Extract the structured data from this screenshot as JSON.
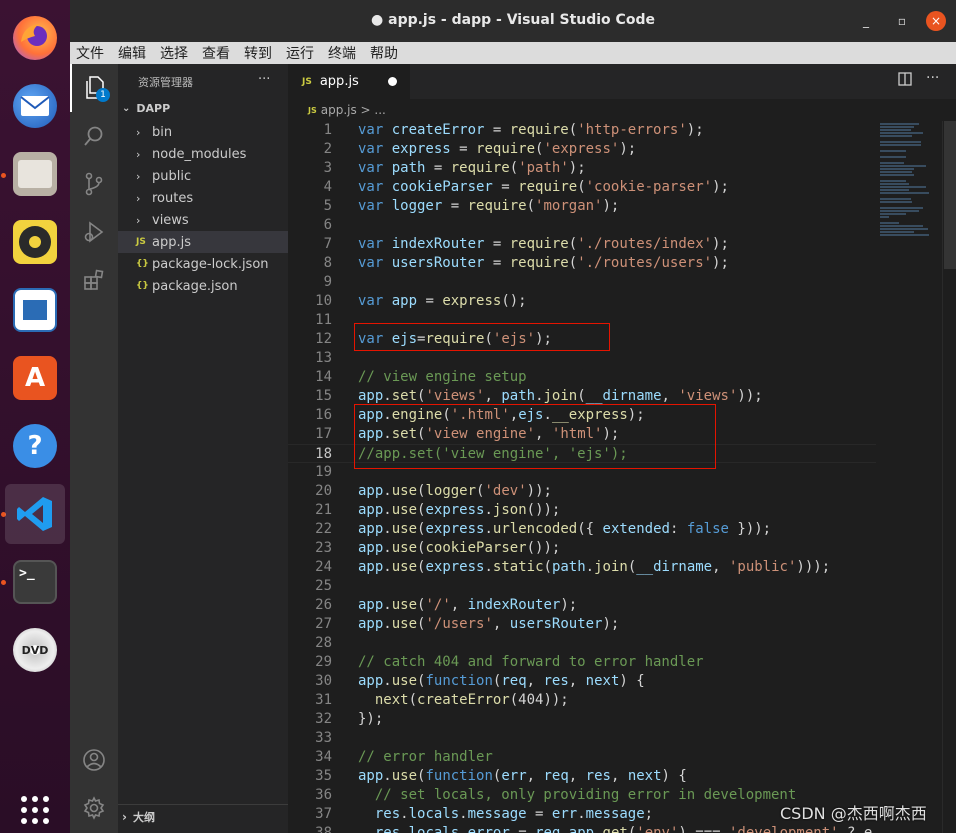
{
  "window": {
    "title": "● app.js - dapp - Visual Studio Code",
    "minimize": "_",
    "maximize": "▫",
    "close": "×"
  },
  "menu": [
    "文件",
    "编辑",
    "选择",
    "查看",
    "转到",
    "运行",
    "终端",
    "帮助"
  ],
  "activity": {
    "badge": "1"
  },
  "sidebar": {
    "title": "资源管理器",
    "more": "···",
    "root": "DAPP",
    "items": [
      {
        "label": "bin",
        "type": "folder"
      },
      {
        "label": "node_modules",
        "type": "folder"
      },
      {
        "label": "public",
        "type": "folder"
      },
      {
        "label": "routes",
        "type": "folder"
      },
      {
        "label": "views",
        "type": "folder"
      },
      {
        "label": "app.js",
        "type": "js"
      },
      {
        "label": "package-lock.json",
        "type": "json"
      },
      {
        "label": "package.json",
        "type": "json"
      }
    ],
    "outline": "大纲"
  },
  "tab": {
    "label": "app.js",
    "icon": "JS"
  },
  "breadcrumb": {
    "icon": "JS",
    "text": "app.js > ..."
  },
  "editor": {
    "current_line": 18,
    "lines": [
      {
        "n": "1",
        "t": [
          [
            "k",
            "var "
          ],
          [
            "v",
            "createError"
          ],
          [
            "p",
            " = "
          ],
          [
            "f",
            "require"
          ],
          [
            "p",
            "("
          ],
          [
            "s",
            "'http-errors'"
          ],
          [
            "p",
            ");"
          ]
        ]
      },
      {
        "n": "2",
        "t": [
          [
            "k",
            "var "
          ],
          [
            "v",
            "express"
          ],
          [
            "p",
            " = "
          ],
          [
            "f",
            "require"
          ],
          [
            "p",
            "("
          ],
          [
            "s",
            "'express'"
          ],
          [
            "p",
            ");"
          ]
        ]
      },
      {
        "n": "3",
        "t": [
          [
            "k",
            "var "
          ],
          [
            "v",
            "path"
          ],
          [
            "p",
            " = "
          ],
          [
            "f",
            "require"
          ],
          [
            "p",
            "("
          ],
          [
            "s",
            "'path'"
          ],
          [
            "p",
            ");"
          ]
        ]
      },
      {
        "n": "4",
        "t": [
          [
            "k",
            "var "
          ],
          [
            "v",
            "cookieParser"
          ],
          [
            "p",
            " = "
          ],
          [
            "f",
            "require"
          ],
          [
            "p",
            "("
          ],
          [
            "s",
            "'cookie-parser'"
          ],
          [
            "p",
            ");"
          ]
        ]
      },
      {
        "n": "5",
        "t": [
          [
            "k",
            "var "
          ],
          [
            "v",
            "logger"
          ],
          [
            "p",
            " = "
          ],
          [
            "f",
            "require"
          ],
          [
            "p",
            "("
          ],
          [
            "s",
            "'morgan'"
          ],
          [
            "p",
            ");"
          ]
        ]
      },
      {
        "n": "6",
        "t": []
      },
      {
        "n": "7",
        "t": [
          [
            "k",
            "var "
          ],
          [
            "v",
            "indexRouter"
          ],
          [
            "p",
            " = "
          ],
          [
            "f",
            "require"
          ],
          [
            "p",
            "("
          ],
          [
            "s",
            "'./routes/index'"
          ],
          [
            "p",
            ");"
          ]
        ]
      },
      {
        "n": "8",
        "t": [
          [
            "k",
            "var "
          ],
          [
            "v",
            "usersRouter"
          ],
          [
            "p",
            " = "
          ],
          [
            "f",
            "require"
          ],
          [
            "p",
            "("
          ],
          [
            "s",
            "'./routes/users'"
          ],
          [
            "p",
            ");"
          ]
        ]
      },
      {
        "n": "9",
        "t": []
      },
      {
        "n": "10",
        "t": [
          [
            "k",
            "var "
          ],
          [
            "v",
            "app"
          ],
          [
            "p",
            " = "
          ],
          [
            "f",
            "express"
          ],
          [
            "p",
            "();"
          ]
        ]
      },
      {
        "n": "11",
        "t": []
      },
      {
        "n": "12",
        "t": [
          [
            "k",
            "var "
          ],
          [
            "v",
            "ejs"
          ],
          [
            "p",
            "="
          ],
          [
            "f",
            "require"
          ],
          [
            "p",
            "("
          ],
          [
            "s",
            "'ejs'"
          ],
          [
            "p",
            ");"
          ]
        ]
      },
      {
        "n": "13",
        "t": []
      },
      {
        "n": "14",
        "t": [
          [
            "c",
            "// view engine setup"
          ]
        ]
      },
      {
        "n": "15",
        "t": [
          [
            "v",
            "app"
          ],
          [
            "p",
            "."
          ],
          [
            "f",
            "set"
          ],
          [
            "p",
            "("
          ],
          [
            "s",
            "'views'"
          ],
          [
            "p",
            ", "
          ],
          [
            "v",
            "path"
          ],
          [
            "p",
            "."
          ],
          [
            "f",
            "join"
          ],
          [
            "p",
            "("
          ],
          [
            "v",
            "__dirname"
          ],
          [
            "p",
            ", "
          ],
          [
            "s",
            "'views'"
          ],
          [
            "p",
            "));"
          ]
        ]
      },
      {
        "n": "16",
        "t": [
          [
            "v",
            "app"
          ],
          [
            "p",
            "."
          ],
          [
            "f",
            "engine"
          ],
          [
            "p",
            "("
          ],
          [
            "s",
            "'.html'"
          ],
          [
            "p",
            ","
          ],
          [
            "v",
            "ejs"
          ],
          [
            "p",
            "."
          ],
          [
            "f",
            "__express"
          ],
          [
            "p",
            ");"
          ]
        ]
      },
      {
        "n": "17",
        "t": [
          [
            "v",
            "app"
          ],
          [
            "p",
            "."
          ],
          [
            "f",
            "set"
          ],
          [
            "p",
            "("
          ],
          [
            "s",
            "'view engine'"
          ],
          [
            "p",
            ", "
          ],
          [
            "s",
            "'html'"
          ],
          [
            "p",
            ");"
          ]
        ]
      },
      {
        "n": "18",
        "t": [
          [
            "c",
            "//app.set('view engine', 'ejs');"
          ]
        ]
      },
      {
        "n": "19",
        "t": []
      },
      {
        "n": "20",
        "t": [
          [
            "v",
            "app"
          ],
          [
            "p",
            "."
          ],
          [
            "f",
            "use"
          ],
          [
            "p",
            "("
          ],
          [
            "f",
            "logger"
          ],
          [
            "p",
            "("
          ],
          [
            "s",
            "'dev'"
          ],
          [
            "p",
            "));"
          ]
        ]
      },
      {
        "n": "21",
        "t": [
          [
            "v",
            "app"
          ],
          [
            "p",
            "."
          ],
          [
            "f",
            "use"
          ],
          [
            "p",
            "("
          ],
          [
            "v",
            "express"
          ],
          [
            "p",
            "."
          ],
          [
            "f",
            "json"
          ],
          [
            "p",
            "());"
          ]
        ]
      },
      {
        "n": "22",
        "t": [
          [
            "v",
            "app"
          ],
          [
            "p",
            "."
          ],
          [
            "f",
            "use"
          ],
          [
            "p",
            "("
          ],
          [
            "v",
            "express"
          ],
          [
            "p",
            "."
          ],
          [
            "f",
            "urlencoded"
          ],
          [
            "p",
            "({ "
          ],
          [
            "v",
            "extended"
          ],
          [
            "p",
            ": "
          ],
          [
            "k",
            "false"
          ],
          [
            "p",
            " }));"
          ]
        ]
      },
      {
        "n": "23",
        "t": [
          [
            "v",
            "app"
          ],
          [
            "p",
            "."
          ],
          [
            "f",
            "use"
          ],
          [
            "p",
            "("
          ],
          [
            "f",
            "cookieParser"
          ],
          [
            "p",
            "());"
          ]
        ]
      },
      {
        "n": "24",
        "t": [
          [
            "v",
            "app"
          ],
          [
            "p",
            "."
          ],
          [
            "f",
            "use"
          ],
          [
            "p",
            "("
          ],
          [
            "v",
            "express"
          ],
          [
            "p",
            "."
          ],
          [
            "f",
            "static"
          ],
          [
            "p",
            "("
          ],
          [
            "v",
            "path"
          ],
          [
            "p",
            "."
          ],
          [
            "f",
            "join"
          ],
          [
            "p",
            "("
          ],
          [
            "v",
            "__dirname"
          ],
          [
            "p",
            ", "
          ],
          [
            "s",
            "'public'"
          ],
          [
            "p",
            ")));"
          ]
        ]
      },
      {
        "n": "25",
        "t": []
      },
      {
        "n": "26",
        "t": [
          [
            "v",
            "app"
          ],
          [
            "p",
            "."
          ],
          [
            "f",
            "use"
          ],
          [
            "p",
            "("
          ],
          [
            "s",
            "'/'"
          ],
          [
            "p",
            ", "
          ],
          [
            "v",
            "indexRouter"
          ],
          [
            "p",
            ");"
          ]
        ]
      },
      {
        "n": "27",
        "t": [
          [
            "v",
            "app"
          ],
          [
            "p",
            "."
          ],
          [
            "f",
            "use"
          ],
          [
            "p",
            "("
          ],
          [
            "s",
            "'/users'"
          ],
          [
            "p",
            ", "
          ],
          [
            "v",
            "usersRouter"
          ],
          [
            "p",
            ");"
          ]
        ]
      },
      {
        "n": "28",
        "t": []
      },
      {
        "n": "29",
        "t": [
          [
            "c",
            "// catch 404 and forward to error handler"
          ]
        ]
      },
      {
        "n": "30",
        "t": [
          [
            "v",
            "app"
          ],
          [
            "p",
            "."
          ],
          [
            "f",
            "use"
          ],
          [
            "p",
            "("
          ],
          [
            "k",
            "function"
          ],
          [
            "p",
            "("
          ],
          [
            "v",
            "req"
          ],
          [
            "p",
            ", "
          ],
          [
            "v",
            "res"
          ],
          [
            "p",
            ", "
          ],
          [
            "v",
            "next"
          ],
          [
            "p",
            ") {"
          ]
        ]
      },
      {
        "n": "31",
        "t": [
          [
            "p",
            "  "
          ],
          [
            "f",
            "next"
          ],
          [
            "p",
            "("
          ],
          [
            "f",
            "createError"
          ],
          [
            "p",
            "(404));"
          ]
        ]
      },
      {
        "n": "32",
        "t": [
          [
            "p",
            "});"
          ]
        ]
      },
      {
        "n": "33",
        "t": []
      },
      {
        "n": "34",
        "t": [
          [
            "c",
            "// error handler"
          ]
        ]
      },
      {
        "n": "35",
        "t": [
          [
            "v",
            "app"
          ],
          [
            "p",
            "."
          ],
          [
            "f",
            "use"
          ],
          [
            "p",
            "("
          ],
          [
            "k",
            "function"
          ],
          [
            "p",
            "("
          ],
          [
            "v",
            "err"
          ],
          [
            "p",
            ", "
          ],
          [
            "v",
            "req"
          ],
          [
            "p",
            ", "
          ],
          [
            "v",
            "res"
          ],
          [
            "p",
            ", "
          ],
          [
            "v",
            "next"
          ],
          [
            "p",
            ") {"
          ]
        ]
      },
      {
        "n": "36",
        "t": [
          [
            "c",
            "  // set locals, only providing error in development"
          ]
        ]
      },
      {
        "n": "37",
        "t": [
          [
            "p",
            "  "
          ],
          [
            "v",
            "res"
          ],
          [
            "p",
            "."
          ],
          [
            "v",
            "locals"
          ],
          [
            "p",
            "."
          ],
          [
            "v",
            "message"
          ],
          [
            "p",
            " = "
          ],
          [
            "v",
            "err"
          ],
          [
            "p",
            "."
          ],
          [
            "v",
            "message"
          ],
          [
            "p",
            ";"
          ]
        ]
      },
      {
        "n": "38",
        "t": [
          [
            "p",
            "  "
          ],
          [
            "v",
            "res"
          ],
          [
            "p",
            "."
          ],
          [
            "v",
            "locals"
          ],
          [
            "p",
            "."
          ],
          [
            "v",
            "error"
          ],
          [
            "p",
            " = "
          ],
          [
            "v",
            "req"
          ],
          [
            "p",
            "."
          ],
          [
            "v",
            "app"
          ],
          [
            "p",
            "."
          ],
          [
            "f",
            "get"
          ],
          [
            "p",
            "("
          ],
          [
            "s",
            "'env'"
          ],
          [
            "p",
            ") === "
          ],
          [
            "s",
            "'development'"
          ],
          [
            "p",
            " ? e"
          ]
        ]
      }
    ]
  },
  "watermark": "CSDN @杰西啊杰西"
}
